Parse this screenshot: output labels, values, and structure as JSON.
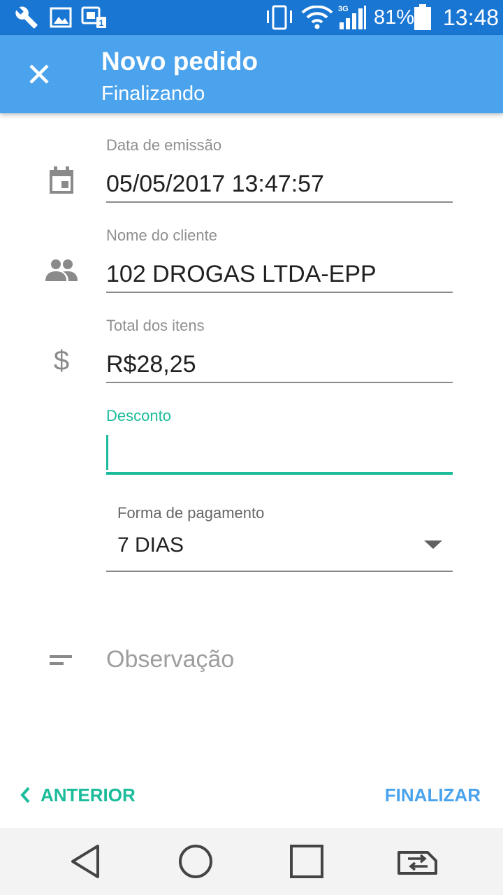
{
  "status_bar": {
    "battery_percent": "81%",
    "time": "13:48",
    "network_type": "3G",
    "icons": [
      "wrench-icon",
      "image-icon",
      "sim-lock-icon",
      "vibrate-icon",
      "wifi-icon",
      "signal-icon",
      "battery-icon"
    ]
  },
  "app_bar": {
    "title": "Novo pedido",
    "subtitle": "Finalizando",
    "close_icon": "close-icon"
  },
  "form": {
    "issue_date": {
      "label": "Data de emissão",
      "value": "05/05/2017 13:47:57",
      "icon": "calendar-icon"
    },
    "client_name": {
      "label": "Nome do cliente",
      "value": "102 DROGAS LTDA-EPP",
      "icon": "people-icon"
    },
    "items_total": {
      "label": "Total dos itens",
      "value": "R$28,25",
      "icon": "dollar-icon"
    },
    "discount": {
      "label": "Desconto",
      "value": ""
    },
    "payment": {
      "label": "Forma de pagamento",
      "value": "7 DIAS"
    },
    "notes": {
      "placeholder": "Observação",
      "icon": "notes-icon"
    }
  },
  "footer": {
    "previous_label": "ANTERIOR",
    "finish_label": "FINALIZAR"
  },
  "colors": {
    "status_bar": "#1976d2",
    "app_bar": "#4aa3ec",
    "accent_teal": "#1bbc9b",
    "accent_blue": "#4aa3ec",
    "icon_grey": "#8a8a8a"
  },
  "nav_bar": {
    "icons": [
      "back-icon",
      "home-icon",
      "recents-icon",
      "switch-sim-icon"
    ]
  }
}
